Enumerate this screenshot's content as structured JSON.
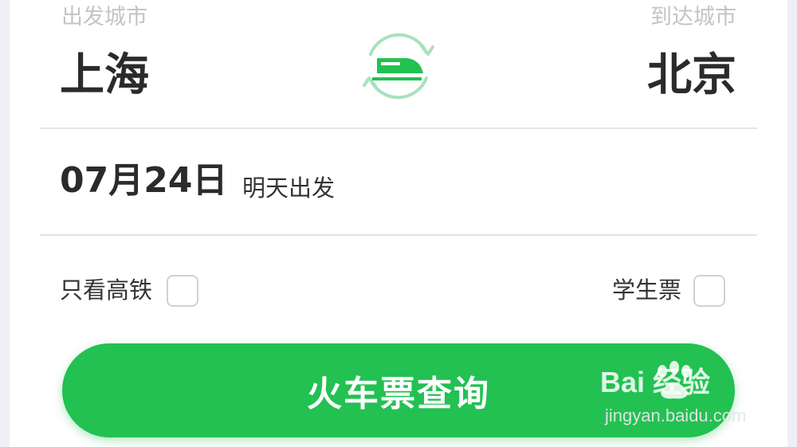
{
  "route": {
    "from_label": "出发城市",
    "from_city": "上海",
    "to_label": "到达城市",
    "to_city": "北京",
    "swap_icon": "train-swap-icon"
  },
  "date": {
    "value": "07月24日",
    "hint": "明天出发"
  },
  "options": {
    "high_speed_label": "只看高铁",
    "high_speed_checked": false,
    "student_label": "学生票",
    "student_checked": false
  },
  "search_button_label": "火车票查询",
  "watermark": {
    "brand": "Bai  经验",
    "url": "jingyan.baidu.com"
  },
  "colors": {
    "accent": "#22c152",
    "swap_ring": "#a8e2bd",
    "text": "#2b2b2b",
    "muted": "#c2c4c9"
  }
}
